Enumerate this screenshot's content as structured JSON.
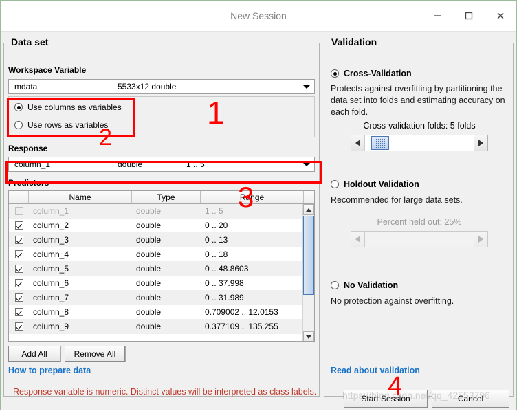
{
  "window": {
    "title": "New Session",
    "minimize_label": "Minimize",
    "maximize_label": "Maximize",
    "close_label": "Close"
  },
  "dataset": {
    "group_title": "Data set",
    "workspace_label": "Workspace Variable",
    "workspace_combo": {
      "name": "mdata",
      "size": "5533x12 double"
    },
    "orientation": {
      "columns_label": "Use columns as variables",
      "rows_label": "Use rows as variables",
      "selected": "columns"
    },
    "response_label": "Response",
    "response_combo": {
      "name": "column_1",
      "type": "double",
      "range": "1 .. 5"
    },
    "predictors_label": "Predictors",
    "table": {
      "headers": [
        "",
        "Name",
        "Type",
        "Range"
      ],
      "rows": [
        {
          "checked": false,
          "enabled": false,
          "name": "column_1",
          "type": "double",
          "range": "1 .. 5"
        },
        {
          "checked": true,
          "enabled": true,
          "name": "column_2",
          "type": "double",
          "range": "0 .. 20"
        },
        {
          "checked": true,
          "enabled": true,
          "name": "column_3",
          "type": "double",
          "range": "0 .. 13"
        },
        {
          "checked": true,
          "enabled": true,
          "name": "column_4",
          "type": "double",
          "range": "0 .. 18"
        },
        {
          "checked": true,
          "enabled": true,
          "name": "column_5",
          "type": "double",
          "range": "0 .. 48.8603"
        },
        {
          "checked": true,
          "enabled": true,
          "name": "column_6",
          "type": "double",
          "range": "0 .. 37.998"
        },
        {
          "checked": true,
          "enabled": true,
          "name": "column_7",
          "type": "double",
          "range": "0 .. 31.989"
        },
        {
          "checked": true,
          "enabled": true,
          "name": "column_8",
          "type": "double",
          "range": "0.709002 .. 12.0153"
        },
        {
          "checked": true,
          "enabled": true,
          "name": "column_9",
          "type": "double",
          "range": "0.377109 .. 135.255"
        }
      ]
    },
    "add_all_label": "Add All",
    "remove_all_label": "Remove All",
    "help_link": "How to prepare data"
  },
  "validation": {
    "group_title": "Validation",
    "selected": "cross",
    "cross": {
      "label": "Cross-Validation",
      "description": "Protects against overfitting by partitioning the data set into folds and estimating accuracy on each fold.",
      "slider_label": "Cross-validation folds: 5 folds",
      "folds": 5
    },
    "holdout": {
      "label": "Holdout Validation",
      "description": "Recommended for large data sets.",
      "slider_label": "Percent held out: 25%",
      "percent": 25
    },
    "none": {
      "label": "No Validation",
      "description": "No protection against overfitting."
    },
    "help_link": "Read about validation"
  },
  "footer": {
    "status_message": "Response variable is numeric. Distinct values will be interpreted as class labels.",
    "start_label": "Start Session",
    "cancel_label": "Cancel"
  },
  "annotations": {
    "one": "1",
    "two": "2",
    "three": "3",
    "four": "4"
  },
  "watermark": {
    "text": "https://blog.csdn.net/qq_42553796"
  },
  "colors": {
    "accent_link": "#1a73c8",
    "status_red": "#c0392b",
    "annotation_red": "#ff0000",
    "panel_bg": "#f0f0f0",
    "selection_blue": "#4a78b5"
  }
}
